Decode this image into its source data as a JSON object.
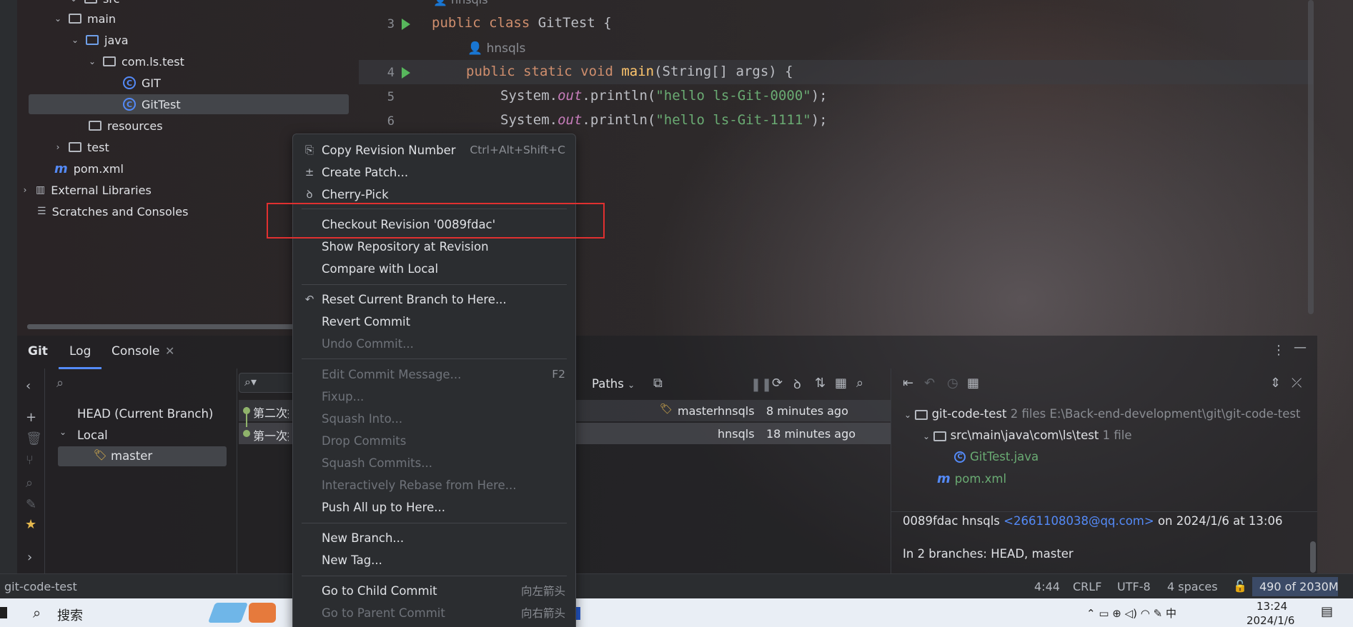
{
  "project_tree": {
    "items": [
      {
        "label": "src",
        "type": "folder"
      },
      {
        "label": "main",
        "type": "folder"
      },
      {
        "label": "java",
        "type": "folder-blue"
      },
      {
        "label": "com.ls.test",
        "type": "package"
      },
      {
        "label": "GIT",
        "type": "class"
      },
      {
        "label": "GitTest",
        "type": "class",
        "selected": true
      },
      {
        "label": "resources",
        "type": "folder"
      },
      {
        "label": "test",
        "type": "folder"
      },
      {
        "label": "pom.xml",
        "type": "maven"
      },
      {
        "label": "External Libraries",
        "type": "library"
      },
      {
        "label": "Scratches and Consoles",
        "type": "scratches"
      }
    ]
  },
  "editor": {
    "author_top": "hnsqls",
    "author_inline": "hnsqls",
    "lines": [
      {
        "num": "3"
      },
      {
        "num": "4"
      },
      {
        "num": "5"
      },
      {
        "num": "6"
      }
    ],
    "code": {
      "l3_kw": "public class ",
      "l3_name": "GitTest",
      " l3_end": " {",
      "l4_kw": "public static void ",
      "l4_name": "main",
      "l4_args": "(String[] args) {",
      "l5_pre": "System.",
      "l5_out": "out",
      "l5_mid": ".println(",
      "l5_str": "\"hello ls-Git-0000\"",
      "l5_end": ");",
      "l6_pre": "System.",
      "l6_out": "out",
      "l6_mid": ".println(",
      "l6_str": "\"hello ls-Git-1111\"",
      "l6_end": ");"
    }
  },
  "context_menu": {
    "items": [
      {
        "label": "Copy Revision Number",
        "shortcut": "Ctrl+Alt+Shift+C",
        "icon": "copy-icon"
      },
      {
        "label": "Create Patch...",
        "icon": "patch-icon"
      },
      {
        "label": "Cherry-Pick",
        "icon": "cherry-pick-icon"
      },
      {
        "label": "Checkout Revision '0089fdac'"
      },
      {
        "label": "Show Repository at Revision"
      },
      {
        "label": "Compare with Local"
      },
      {
        "label": "Reset Current Branch to Here...",
        "icon": "reset-icon"
      },
      {
        "label": "Revert Commit"
      },
      {
        "label": "Undo Commit...",
        "disabled": true
      },
      {
        "label": "Edit Commit Message...",
        "shortcut": "F2",
        "disabled": true
      },
      {
        "label": "Fixup...",
        "disabled": true
      },
      {
        "label": "Squash Into...",
        "disabled": true
      },
      {
        "label": "Drop Commits",
        "disabled": true
      },
      {
        "label": "Squash Commits...",
        "disabled": true
      },
      {
        "label": "Interactively Rebase from Here...",
        "disabled": true
      },
      {
        "label": "Push All up to Here..."
      },
      {
        "label": "New Branch..."
      },
      {
        "label": "New Tag..."
      },
      {
        "label": "Go to Child Commit",
        "shortcut": "向左箭头"
      },
      {
        "label": "Go to Parent Commit",
        "shortcut": "向右箭头",
        "disabled": true
      }
    ],
    "highlight_color": "#e03030"
  },
  "tool_window": {
    "tabs": [
      {
        "label": "Git"
      },
      {
        "label": "Log"
      },
      {
        "label": "Console"
      }
    ],
    "branches": {
      "head": "HEAD (Current Branch)",
      "local": "Local",
      "master": "master"
    },
    "log": {
      "paths_label": "Paths",
      "commits": [
        {
          "msg": "第二次提",
          "branch": "master",
          "author": "hnsqls",
          "time": "8 minutes ago"
        },
        {
          "msg": "第一次提",
          "author": "hnsqls",
          "time": "18 minutes ago"
        }
      ]
    },
    "changes": {
      "root": "git-code-test",
      "root_meta": "2 files",
      "root_path": "E:\\Back-end-development\\git\\git-code-test",
      "dir": "src\\main\\java\\com\\ls\\test",
      "dir_meta": "1 file",
      "file1": "GitTest.java",
      "file2": "pom.xml"
    },
    "details": {
      "hash": "0089fdac",
      "author": "hnsqls",
      "email": "<2661108038@qq.com>",
      "date": "on 2024/1/6 at 13:06",
      "branches": "In 2 branches: HEAD, master"
    }
  },
  "status_bar": {
    "project": "git-code-test",
    "position": "4:44",
    "line_sep": "CRLF",
    "encoding": "UTF-8",
    "indent": "4 spaces",
    "memory": "490 of 2030M"
  },
  "taskbar": {
    "search": "搜索",
    "time": "13:24",
    "date": "2024/1/6",
    "ime": "中"
  }
}
